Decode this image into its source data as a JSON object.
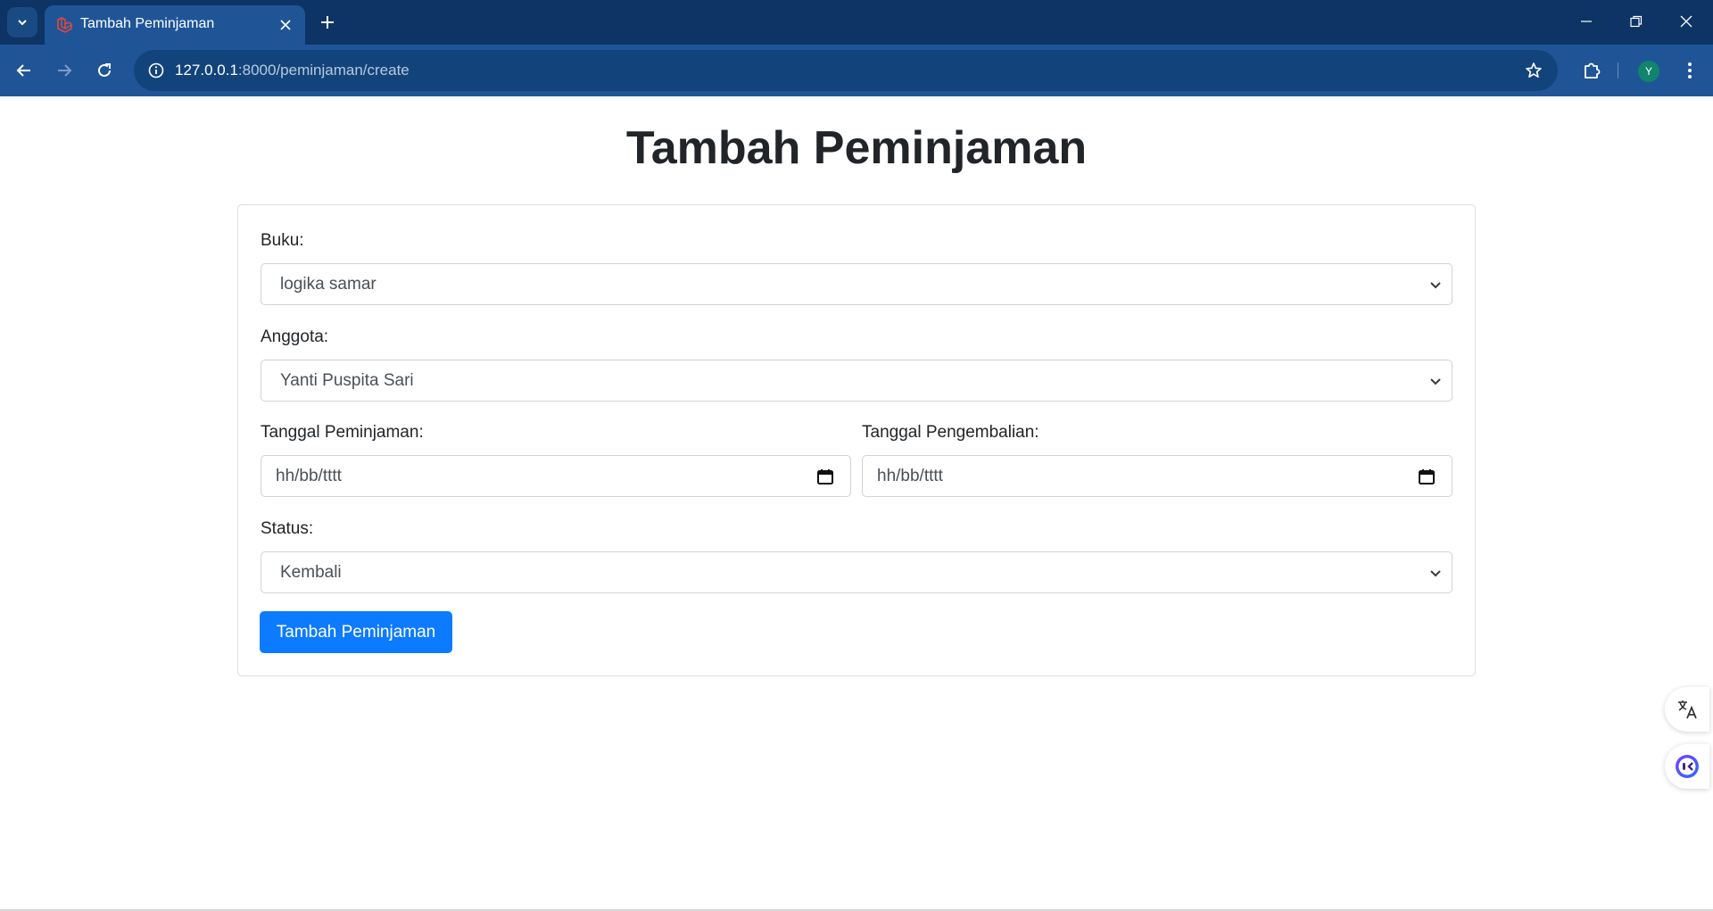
{
  "browser": {
    "tab_title": "Tambah Peminjaman",
    "url_host": "127.0.0.1",
    "url_path": ":8000/peminjaman/create",
    "profile_initial": "Y",
    "colors": {
      "tabbar": "#0d3464",
      "toolbar": "#1f5597",
      "omnibox": "#13437b"
    }
  },
  "page": {
    "title": "Tambah Peminjaman",
    "form": {
      "buku_label": "Buku:",
      "buku_value": "logika samar",
      "anggota_label": "Anggota:",
      "anggota_value": "Yanti Puspita Sari",
      "tanggal_peminjaman_label": "Tanggal Peminjaman:",
      "tanggal_peminjaman_placeholder": "hh/bb/tttt",
      "tanggal_pengembalian_label": "Tanggal Pengembalian:",
      "tanggal_pengembalian_placeholder": "hh/bb/tttt",
      "status_label": "Status:",
      "status_value": "Kembali",
      "submit_label": "Tambah Peminjaman"
    },
    "colors": {
      "primary": "#0d7bff",
      "text": "#212529",
      "border": "#ced4da"
    }
  },
  "icons": {
    "tab_list": "chevron-down-icon",
    "favicon": "laravel-icon",
    "close": "close-icon",
    "new_tab": "plus-icon",
    "back": "arrow-left-icon",
    "forward": "arrow-right-icon",
    "reload": "reload-icon",
    "site_info": "info-icon",
    "bookmark": "star-icon",
    "extensions": "puzzle-icon",
    "menu": "kebab-menu-icon",
    "calendar": "calendar-icon",
    "translate": "translate-icon",
    "assistant": "assistant-icon"
  }
}
